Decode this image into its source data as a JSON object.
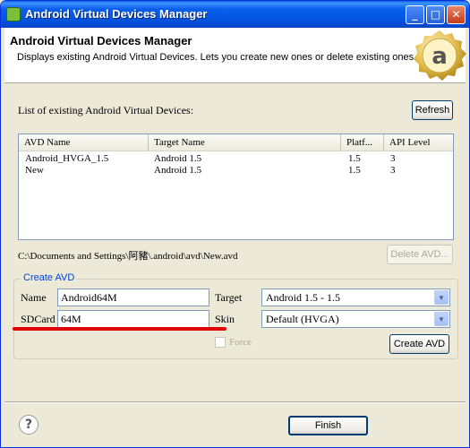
{
  "window": {
    "title": "Android Virtual Devices Manager",
    "icon": "android-app-icon",
    "controls": {
      "minimize": "_",
      "maximize": "□",
      "close": "✕"
    }
  },
  "banner": {
    "title": "Android Virtual Devices Manager",
    "description": "Displays existing Android Virtual Devices. Lets you create new ones or delete existing ones.",
    "logo_letter": "a"
  },
  "list": {
    "label": "List of existing Android Virtual Devices:",
    "refresh_label": "Refresh",
    "columns": [
      "AVD Name",
      "Target Name",
      "Platf...",
      "API Level"
    ],
    "rows": [
      [
        "Android_HVGA_1.5",
        "Android 1.5",
        "1.5",
        "3"
      ],
      [
        "New",
        "Android 1.5",
        "1.5",
        "3"
      ]
    ],
    "path": "C:\\Documents and Settings\\阿豬\\.android\\avd\\New.avd",
    "delete_label": "Delete AVD..."
  },
  "create": {
    "legend": "Create AVD",
    "name_label": "Name",
    "name_value": "Android64M",
    "target_label": "Target",
    "target_value": "Android 1.5 - 1.5",
    "sdcard_label": "SDCard",
    "sdcard_value": "64M",
    "skin_label": "Skin",
    "skin_value": "Default (HVGA)",
    "force_label": "Force",
    "create_label": "Create AVD"
  },
  "footer": {
    "help_icon": "?",
    "finish_label": "Finish"
  },
  "colors": {
    "title_bar": "#0a5fe9",
    "annotation_red": "#e00000",
    "legend_blue": "#0046d5"
  }
}
